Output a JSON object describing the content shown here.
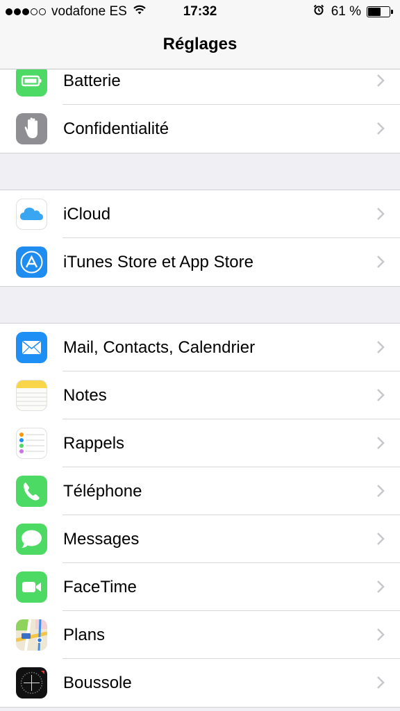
{
  "status_bar": {
    "carrier": "vodafone ES",
    "time": "17:32",
    "battery_percent": "61 %",
    "battery_level": 0.61,
    "signal_dots_filled": 3,
    "signal_dots_total": 5
  },
  "nav": {
    "title": "Réglages"
  },
  "sections": [
    {
      "items": [
        {
          "label": "Batterie",
          "icon": "battery-icon"
        },
        {
          "label": "Confidentialité",
          "icon": "hand-icon"
        }
      ]
    },
    {
      "items": [
        {
          "label": "iCloud",
          "icon": "icloud-icon"
        },
        {
          "label": "iTunes Store et App Store",
          "icon": "app-store-icon"
        }
      ]
    },
    {
      "items": [
        {
          "label": "Mail, Contacts, Calendrier",
          "icon": "mail-icon"
        },
        {
          "label": "Notes",
          "icon": "notes-icon"
        },
        {
          "label": "Rappels",
          "icon": "reminders-icon"
        },
        {
          "label": "Téléphone",
          "icon": "phone-icon"
        },
        {
          "label": "Messages",
          "icon": "messages-icon"
        },
        {
          "label": "FaceTime",
          "icon": "facetime-icon"
        },
        {
          "label": "Plans",
          "icon": "maps-icon"
        },
        {
          "label": "Boussole",
          "icon": "compass-icon"
        }
      ]
    }
  ]
}
